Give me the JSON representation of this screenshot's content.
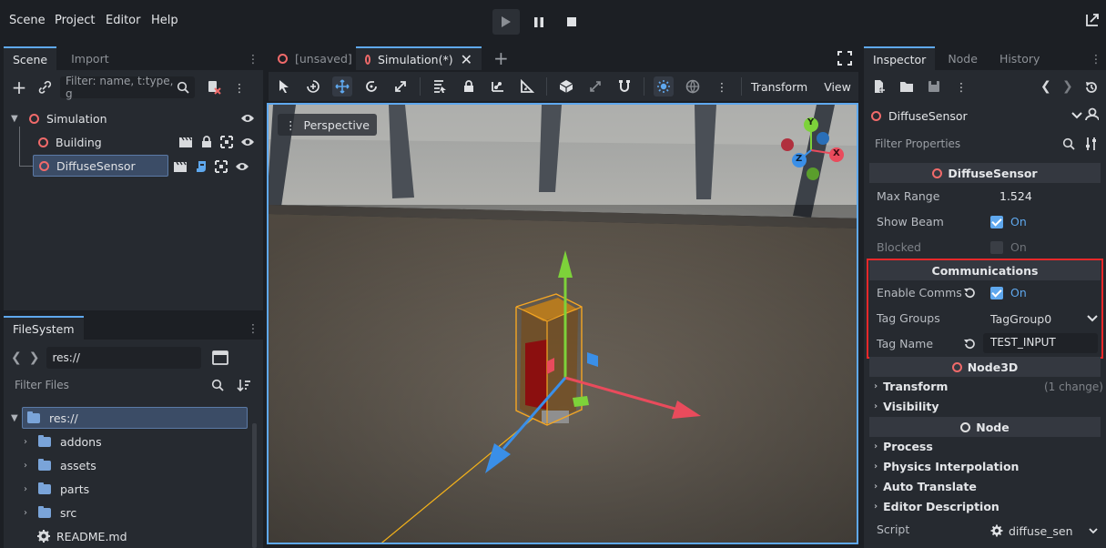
{
  "menu": {
    "scene": "Scene",
    "project": "Project",
    "editor": "Editor",
    "help": "Help"
  },
  "scene_dock": {
    "tabs": [
      "Scene",
      "Import"
    ],
    "filter_placeholder": "Filter: name, t:type, g",
    "tree": [
      {
        "label": "Simulation"
      },
      {
        "label": "Building"
      },
      {
        "label": "DiffuseSensor"
      }
    ]
  },
  "filesystem": {
    "tab": "FileSystem",
    "path": "res://",
    "filter_placeholder": "Filter Files",
    "items": [
      "res://",
      "addons",
      "assets",
      "parts",
      "src",
      "README.md"
    ]
  },
  "editor_tabs": [
    {
      "label": "[unsaved]"
    },
    {
      "label": "Simulation(*)"
    }
  ],
  "toolbar": {
    "transform": "Transform",
    "view": "View"
  },
  "viewport": {
    "perspective": "Perspective",
    "gizmo": {
      "y": "Y",
      "x": "X",
      "z": "Z"
    }
  },
  "inspector": {
    "tabs": [
      "Inspector",
      "Node",
      "History"
    ],
    "node_name": "DiffuseSensor",
    "filter_placeholder": "Filter Properties",
    "section_sensor": "DiffuseSensor",
    "props": {
      "max_range_label": "Max Range",
      "max_range_value": "1.524",
      "show_beam_label": "Show Beam",
      "show_beam_value": "On",
      "blocked_label": "Blocked",
      "blocked_value": "On"
    },
    "section_comms": "Communications",
    "comms": {
      "enable_label": "Enable Comms",
      "enable_value": "On",
      "tag_groups_label": "Tag Groups",
      "tag_groups_value": "TagGroup0",
      "tag_name_label": "Tag Name",
      "tag_name_value": "TEST_INPUT"
    },
    "section_node3d": "Node3D",
    "node3d_cats": {
      "transform": "Transform",
      "transform_note": "(1 change)",
      "visibility": "Visibility"
    },
    "section_node": "Node",
    "node_cats": [
      "Process",
      "Physics Interpolation",
      "Auto Translate",
      "Editor Description"
    ],
    "script_label": "Script",
    "script_value": "diffuse_sen"
  },
  "colors": {
    "accent": "#5fa8ee",
    "highlight": "#e8282a",
    "node_ring": "#f06a6a"
  }
}
